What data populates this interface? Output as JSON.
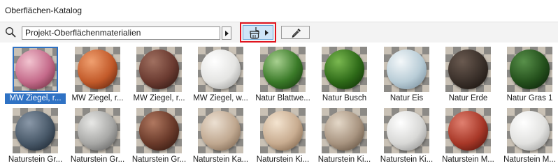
{
  "window": {
    "title": "Oberflächen-Katalog"
  },
  "toolbar": {
    "search_icon": "search-icon",
    "source_value": "Projekt-Oberflächenmaterialien",
    "dropdown_icon": "caret-right-icon",
    "paint_icon": "paint-brush-icon",
    "pick_icon": "eyedropper-icon",
    "highlight_color": "#e0141e",
    "active_button_color": "#cfe5f7"
  },
  "selection_color": "#2f72c4",
  "materials": [
    {
      "label": "MW Ziegel, r...",
      "selected": true,
      "colors": [
        "#f2c4d0",
        "#c46a8a",
        "#5a2030"
      ]
    },
    {
      "label": "MW Ziegel, r...",
      "colors": [
        "#f0a070",
        "#c25a2a",
        "#4a1808"
      ]
    },
    {
      "label": "MW Ziegel, r...",
      "colors": [
        "#a07060",
        "#6a3a30",
        "#22100c"
      ]
    },
    {
      "label": "MW Ziegel, w...",
      "colors": [
        "#ffffff",
        "#e4e4e2",
        "#8a8a88"
      ]
    },
    {
      "label": "Natur Blattwe...",
      "colors": [
        "#a8d090",
        "#3a7a28",
        "#0e2a08"
      ]
    },
    {
      "label": "Natur Busch",
      "colors": [
        "#7ab850",
        "#2e6a18",
        "#0a2204"
      ]
    },
    {
      "label": "Natur Eis",
      "colors": [
        "#f4f8fa",
        "#b8ccd6",
        "#6a8090"
      ]
    },
    {
      "label": "Natur Erde",
      "colors": [
        "#6a5a50",
        "#3a302a",
        "#120c08"
      ]
    },
    {
      "label": "Natur Gras 1",
      "colors": [
        "#58904a",
        "#24501c",
        "#061606"
      ]
    },
    {
      "label": "Naturstein Gr...",
      "colors": [
        "#8a98a8",
        "#485868",
        "#121a24"
      ]
    },
    {
      "label": "Naturstein Gr...",
      "colors": [
        "#e8e8e6",
        "#a8a8a6",
        "#505050"
      ]
    },
    {
      "label": "Naturstein Gr...",
      "colors": [
        "#b07860",
        "#6a3a2a",
        "#24100a"
      ]
    },
    {
      "label": "Naturstein Ka...",
      "colors": [
        "#ece0d2",
        "#c0a890",
        "#6a5440"
      ]
    },
    {
      "label": "Naturstein Ki...",
      "colors": [
        "#f4e4d0",
        "#c8ac90",
        "#6a5038"
      ]
    },
    {
      "label": "Naturstein Ki...",
      "colors": [
        "#e4d8c8",
        "#a89480",
        "#504030"
      ]
    },
    {
      "label": "Naturstein Ki...",
      "colors": [
        "#ffffff",
        "#d8d8d6",
        "#808080"
      ]
    },
    {
      "label": "Naturstein M...",
      "colors": [
        "#e08070",
        "#a83828",
        "#400c06"
      ]
    },
    {
      "label": "Naturstein M...",
      "colors": [
        "#ffffff",
        "#e2e2e0",
        "#8c8c8a"
      ]
    }
  ]
}
